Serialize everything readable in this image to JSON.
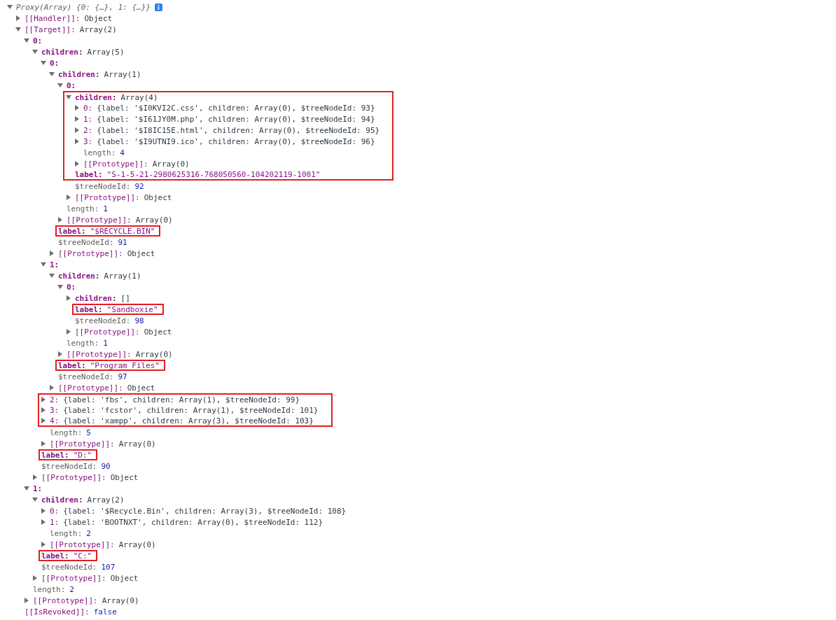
{
  "console": {
    "summary": "Proxy(Array) {0: {…}, 1: {…}}",
    "expanded": true,
    "children": [
      {
        "key": "[[Handler]]:",
        "enumerable": false,
        "dimmed": false,
        "value": "Object",
        "kind": "object",
        "expanded": false,
        "highlighted": false
      },
      {
        "key": "[[Target]]:",
        "enumerable": false,
        "dimmed": false,
        "value": "Array(2)",
        "kind": "object",
        "expanded": true,
        "highlighted": false,
        "children": [
          {
            "key": "0:",
            "enumerable": true,
            "dimmed": false,
            "expanded": true,
            "highlighted": false,
            "children": [
              {
                "key": "children:",
                "enumerable": true,
                "dimmed": false,
                "value": "Array(5)",
                "kind": "object",
                "expanded": true,
                "highlighted": false,
                "children": [
                  {
                    "key": "0:",
                    "enumerable": true,
                    "dimmed": false,
                    "expanded": true,
                    "highlighted": false,
                    "children": [
                      {
                        "key": "children:",
                        "enumerable": true,
                        "dimmed": false,
                        "value": "Array(1)",
                        "kind": "object",
                        "expanded": true,
                        "highlighted": false,
                        "children": [
                          {
                            "key": "0:",
                            "enumerable": true,
                            "dimmed": false,
                            "expanded": true,
                            "highlighted": false,
                            "children": [
                              {
                                "key": "children:",
                                "enumerable": true,
                                "dimmed": false,
                                "value": "Array(4)",
                                "kind": "object",
                                "expanded": true,
                                "highlighted": true,
                                "children": [
                                  {
                                    "key": "0:",
                                    "enumerable": false,
                                    "dimmed": false,
                                    "value": "{label: '$I0KVI2C.css', children: Array(0), $treeNodeId: 93}",
                                    "kind": "preview",
                                    "expanded": false,
                                    "highlighted": true
                                  },
                                  {
                                    "key": "1:",
                                    "enumerable": false,
                                    "dimmed": false,
                                    "value": "{label: '$I61JY0M.php', children: Array(0), $treeNodeId: 94}",
                                    "kind": "preview",
                                    "expanded": false,
                                    "highlighted": true
                                  },
                                  {
                                    "key": "2:",
                                    "enumerable": false,
                                    "dimmed": false,
                                    "value": "{label: '$I8IC15E.html', children: Array(0), $treeNodeId: 95}",
                                    "kind": "preview",
                                    "expanded": false,
                                    "highlighted": true
                                  },
                                  {
                                    "key": "3:",
                                    "enumerable": false,
                                    "dimmed": false,
                                    "value": "{label: '$I9UTNI9.ico', children: Array(0), $treeNodeId: 96}",
                                    "kind": "preview",
                                    "expanded": false,
                                    "highlighted": true
                                  },
                                  {
                                    "key": "length:",
                                    "enumerable": false,
                                    "dimmed": true,
                                    "value": "4",
                                    "kind": "number",
                                    "highlighted": true
                                  },
                                  {
                                    "key": "[[Prototype]]:",
                                    "enumerable": false,
                                    "dimmed": false,
                                    "value": "Array(0)",
                                    "kind": "object",
                                    "expanded": false,
                                    "highlighted": true
                                  }
                                ]
                              },
                              {
                                "key": "label:",
                                "enumerable": true,
                                "dimmed": false,
                                "value": "\"S-1-5-21-2980625316-768050560-104202119-1001\"",
                                "kind": "string",
                                "highlighted": true
                              },
                              {
                                "key": "$treeNodeId:",
                                "enumerable": false,
                                "dimmed": true,
                                "value": "92",
                                "kind": "number",
                                "highlighted": false
                              },
                              {
                                "key": "[[Prototype]]:",
                                "enumerable": false,
                                "dimmed": false,
                                "value": "Object",
                                "kind": "object",
                                "expanded": false,
                                "highlighted": false
                              }
                            ]
                          },
                          {
                            "key": "length:",
                            "enumerable": false,
                            "dimmed": true,
                            "value": "1",
                            "kind": "number",
                            "highlighted": false
                          },
                          {
                            "key": "[[Prototype]]:",
                            "enumerable": false,
                            "dimmed": false,
                            "value": "Array(0)",
                            "kind": "object",
                            "expanded": false,
                            "highlighted": false
                          }
                        ]
                      },
                      {
                        "key": "label:",
                        "enumerable": true,
                        "dimmed": false,
                        "value": "\"$RECYCLE.BIN\"",
                        "kind": "string",
                        "highlighted": true
                      },
                      {
                        "key": "$treeNodeId:",
                        "enumerable": false,
                        "dimmed": true,
                        "value": "91",
                        "kind": "number",
                        "highlighted": false
                      },
                      {
                        "key": "[[Prototype]]:",
                        "enumerable": false,
                        "dimmed": false,
                        "value": "Object",
                        "kind": "object",
                        "expanded": false,
                        "highlighted": false
                      }
                    ]
                  },
                  {
                    "key": "1:",
                    "enumerable": true,
                    "dimmed": false,
                    "expanded": true,
                    "highlighted": false,
                    "children": [
                      {
                        "key": "children:",
                        "enumerable": true,
                        "dimmed": false,
                        "value": "Array(1)",
                        "kind": "object",
                        "expanded": true,
                        "highlighted": false,
                        "children": [
                          {
                            "key": "0:",
                            "enumerable": true,
                            "dimmed": false,
                            "expanded": true,
                            "highlighted": false,
                            "children": [
                              {
                                "key": "children:",
                                "enumerable": true,
                                "dimmed": false,
                                "value": "[]",
                                "kind": "object",
                                "expanded": false,
                                "highlighted": false
                              },
                              {
                                "key": "label:",
                                "enumerable": true,
                                "dimmed": false,
                                "value": "\"Sandboxie\"",
                                "kind": "string",
                                "highlighted": true
                              },
                              {
                                "key": "$treeNodeId:",
                                "enumerable": false,
                                "dimmed": true,
                                "value": "98",
                                "kind": "number",
                                "highlighted": false
                              },
                              {
                                "key": "[[Prototype]]:",
                                "enumerable": false,
                                "dimmed": false,
                                "value": "Object",
                                "kind": "object",
                                "expanded": false,
                                "highlighted": false
                              }
                            ]
                          },
                          {
                            "key": "length:",
                            "enumerable": false,
                            "dimmed": true,
                            "value": "1",
                            "kind": "number",
                            "highlighted": false
                          },
                          {
                            "key": "[[Prototype]]:",
                            "enumerable": false,
                            "dimmed": false,
                            "value": "Array(0)",
                            "kind": "object",
                            "expanded": false,
                            "highlighted": false
                          }
                        ]
                      },
                      {
                        "key": "label:",
                        "enumerable": true,
                        "dimmed": false,
                        "value": "\"Program Files\"",
                        "kind": "string",
                        "highlighted": true
                      },
                      {
                        "key": "$treeNodeId:",
                        "enumerable": false,
                        "dimmed": true,
                        "value": "97",
                        "kind": "number",
                        "highlighted": false
                      },
                      {
                        "key": "[[Prototype]]:",
                        "enumerable": false,
                        "dimmed": false,
                        "value": "Object",
                        "kind": "object",
                        "expanded": false,
                        "highlighted": false
                      }
                    ]
                  },
                  {
                    "key": "2:",
                    "enumerable": false,
                    "dimmed": false,
                    "value": "{label: 'fbs', children: Array(1), $treeNodeId: 99}",
                    "kind": "preview",
                    "expanded": false,
                    "highlighted": true
                  },
                  {
                    "key": "3:",
                    "enumerable": false,
                    "dimmed": false,
                    "value": "{label: 'fcstor', children: Array(1), $treeNodeId: 101}",
                    "kind": "preview",
                    "expanded": false,
                    "highlighted": true
                  },
                  {
                    "key": "4:",
                    "enumerable": false,
                    "dimmed": false,
                    "value": "{label: 'xampp', children: Array(3), $treeNodeId: 103}",
                    "kind": "preview",
                    "expanded": false,
                    "highlighted": true
                  },
                  {
                    "key": "length:",
                    "enumerable": false,
                    "dimmed": true,
                    "value": "5",
                    "kind": "number",
                    "highlighted": false
                  },
                  {
                    "key": "[[Prototype]]:",
                    "enumerable": false,
                    "dimmed": false,
                    "value": "Array(0)",
                    "kind": "object",
                    "expanded": false,
                    "highlighted": false
                  }
                ]
              },
              {
                "key": "label:",
                "enumerable": true,
                "dimmed": false,
                "value": "\"D:\"",
                "kind": "string",
                "highlighted": true
              },
              {
                "key": "$treeNodeId:",
                "enumerable": false,
                "dimmed": true,
                "value": "90",
                "kind": "number",
                "highlighted": false
              },
              {
                "key": "[[Prototype]]:",
                "enumerable": false,
                "dimmed": false,
                "value": "Object",
                "kind": "object",
                "expanded": false,
                "highlighted": false
              }
            ]
          },
          {
            "key": "1:",
            "enumerable": true,
            "dimmed": false,
            "expanded": true,
            "highlighted": false,
            "children": [
              {
                "key": "children:",
                "enumerable": true,
                "dimmed": false,
                "value": "Array(2)",
                "kind": "object",
                "expanded": true,
                "highlighted": false,
                "children": [
                  {
                    "key": "0:",
                    "enumerable": false,
                    "dimmed": false,
                    "value": "{label: '$Recycle.Bin', children: Array(3), $treeNodeId: 108}",
                    "kind": "preview",
                    "expanded": false,
                    "highlighted": false
                  },
                  {
                    "key": "1:",
                    "enumerable": false,
                    "dimmed": false,
                    "value": "{label: 'BOOTNXT', children: Array(0), $treeNodeId: 112}",
                    "kind": "preview",
                    "expanded": false,
                    "highlighted": false
                  },
                  {
                    "key": "length:",
                    "enumerable": false,
                    "dimmed": true,
                    "value": "2",
                    "kind": "number",
                    "highlighted": false
                  },
                  {
                    "key": "[[Prototype]]:",
                    "enumerable": false,
                    "dimmed": false,
                    "value": "Array(0)",
                    "kind": "object",
                    "expanded": false,
                    "highlighted": false
                  }
                ]
              },
              {
                "key": "label:",
                "enumerable": true,
                "dimmed": false,
                "value": "\"C:\"",
                "kind": "string",
                "highlighted": true
              },
              {
                "key": "$treeNodeId:",
                "enumerable": false,
                "dimmed": true,
                "value": "107",
                "kind": "number",
                "highlighted": false
              },
              {
                "key": "[[Prototype]]:",
                "enumerable": false,
                "dimmed": false,
                "value": "Object",
                "kind": "object",
                "expanded": false,
                "highlighted": false
              }
            ]
          },
          {
            "key": "length:",
            "enumerable": false,
            "dimmed": true,
            "value": "2",
            "kind": "number",
            "highlighted": false
          },
          {
            "key": "[[Prototype]]:",
            "enumerable": false,
            "dimmed": false,
            "value": "Array(0)",
            "kind": "object",
            "expanded": false,
            "highlighted": false
          }
        ]
      },
      {
        "key": "[[IsRevoked]]:",
        "enumerable": false,
        "dimmed": false,
        "value": "false",
        "kind": "boolean",
        "highlighted": false
      }
    ]
  }
}
